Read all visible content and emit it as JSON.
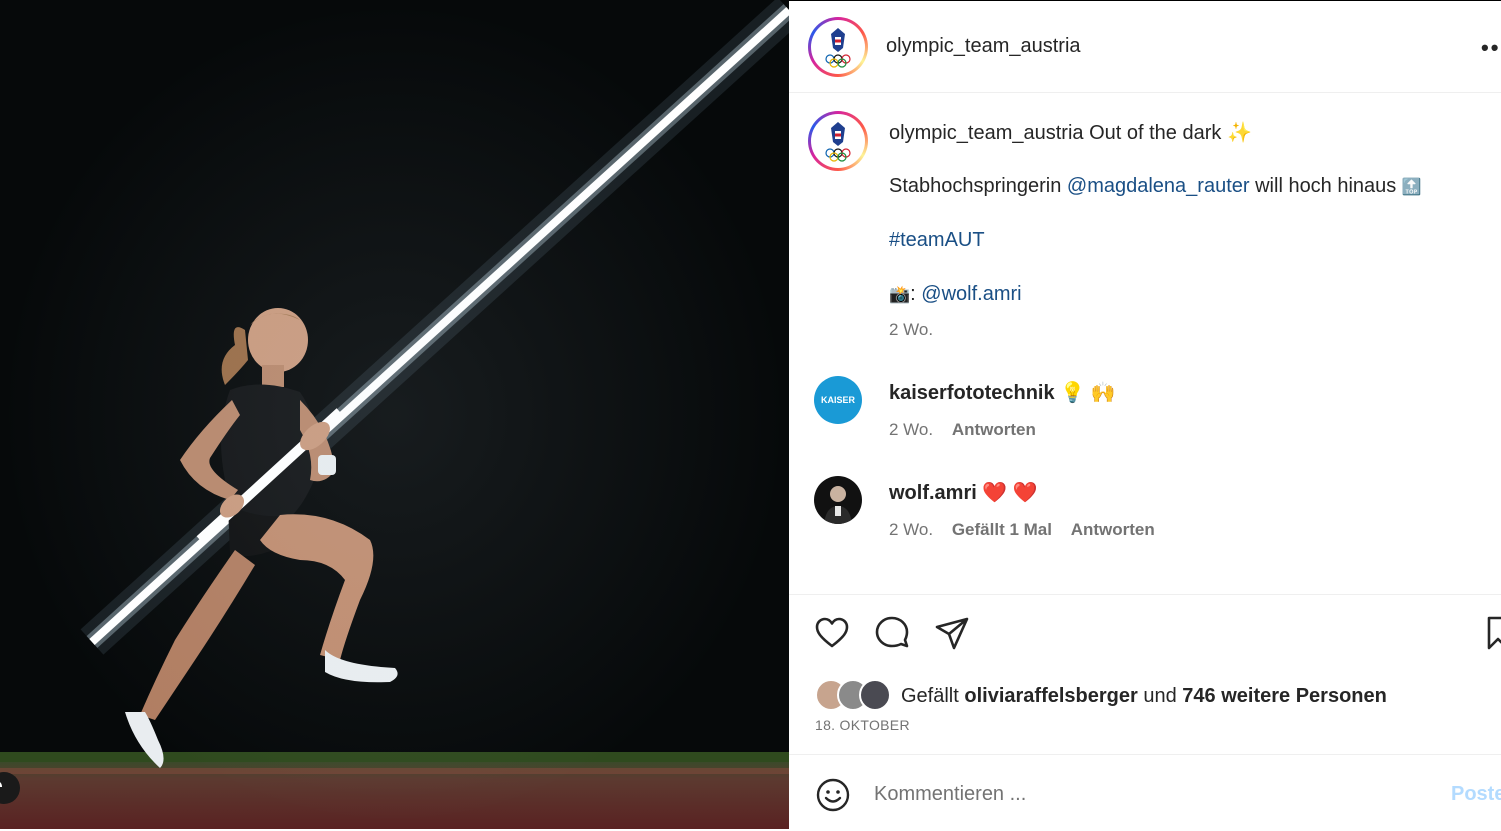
{
  "post": {
    "username": "olympic_team_austria",
    "more_label": "••"
  },
  "caption": {
    "username": "olympic_team_austria",
    "title": "Out of the dark",
    "sparkle": "✨",
    "line2_pre": "Stabhochspringerin",
    "line2_mention": "@magdalena_rauter",
    "line2_post": "will hoch hinaus",
    "line2_emoji": "🔝",
    "hashtag": "#teamAUT",
    "camera": "📸",
    "credit_sep": ":",
    "credit_mention": "@wolf.amri",
    "time": "2 Wo."
  },
  "comments": [
    {
      "username": "kaiserfototechnik",
      "text": "💡 🙌",
      "time": "2 Wo.",
      "likes": "",
      "reply": "Antworten",
      "avatar_text": "KAISER"
    },
    {
      "username": "wolf.amri",
      "text": "❤️ ❤️",
      "time": "2 Wo.",
      "likes": "Gefällt 1 Mal",
      "reply": "Antworten"
    }
  ],
  "likes": {
    "prefix": "Gefällt",
    "user": "oliviaraffelsberger",
    "middle": "und",
    "count": "746 weitere Personen"
  },
  "date": "18. OKTOBER",
  "comment_box": {
    "placeholder": "Kommentieren ...",
    "post_label": "Poste"
  },
  "icons": {
    "like": "heart-icon",
    "comment": "speech-bubble-icon",
    "share": "paper-plane-icon",
    "save": "bookmark-icon",
    "emoji": "smiley-icon",
    "user_tag": "person-icon"
  },
  "colors": {
    "link": "#1a4f85",
    "secondary": "#737373",
    "post_disabled": "#b3dbff",
    "ring_start": "#d6249f",
    "ring_end": "#fdf497"
  }
}
